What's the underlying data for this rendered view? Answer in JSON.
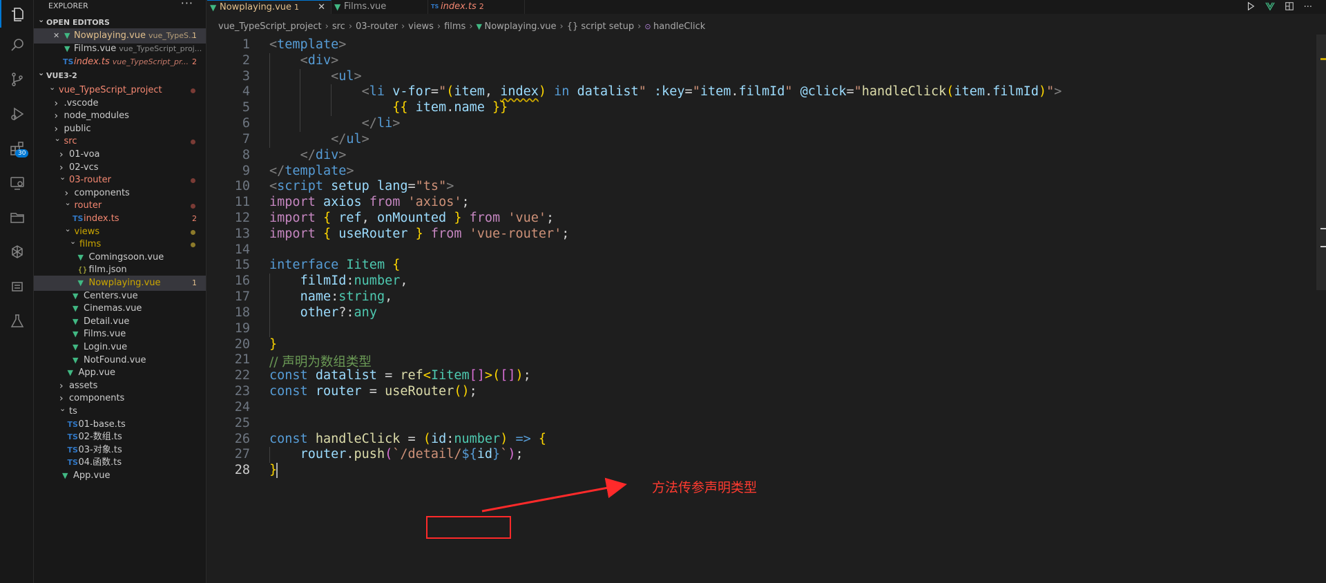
{
  "sidebar": {
    "title": "EXPLORER",
    "more": "···",
    "open_editors_label": "OPEN EDITORS",
    "open_editors": [
      {
        "name": "Nowplaying.vue",
        "desc": "vue_TypeS...",
        "count": "1",
        "kind": "vue",
        "state": "modified",
        "selected": true,
        "closable": true
      },
      {
        "name": "Films.vue",
        "desc": "vue_TypeScript_proj...",
        "count": "",
        "kind": "vue",
        "state": "normal"
      },
      {
        "name": "index.ts",
        "desc": "vue_TypeScript_pr...",
        "count": "2",
        "kind": "ts",
        "state": "error"
      }
    ],
    "workspace_label": "VUE3-2",
    "tree": [
      {
        "name": "vue_TypeScript_project",
        "depth": 0,
        "twisty": "open",
        "kind": "folder",
        "state": "error",
        "dot": true
      },
      {
        "name": ".vscode",
        "depth": 1,
        "twisty": "closed",
        "kind": "folder",
        "state": "normal"
      },
      {
        "name": "node_modules",
        "depth": 1,
        "twisty": "closed",
        "kind": "folder",
        "state": "normal"
      },
      {
        "name": "public",
        "depth": 1,
        "twisty": "closed",
        "kind": "folder",
        "state": "normal"
      },
      {
        "name": "src",
        "depth": 1,
        "twisty": "open",
        "kind": "folder",
        "state": "error",
        "dot": true
      },
      {
        "name": "01-voa",
        "depth": 2,
        "twisty": "closed",
        "kind": "folder",
        "state": "normal"
      },
      {
        "name": "02-vcs",
        "depth": 2,
        "twisty": "closed",
        "kind": "folder",
        "state": "normal"
      },
      {
        "name": "03-router",
        "depth": 2,
        "twisty": "open",
        "kind": "folder",
        "state": "error",
        "dot": true
      },
      {
        "name": "components",
        "depth": 3,
        "twisty": "closed",
        "kind": "folder",
        "state": "normal"
      },
      {
        "name": "router",
        "depth": 3,
        "twisty": "open",
        "kind": "folder",
        "state": "error",
        "dot": true
      },
      {
        "name": "index.ts",
        "depth": 4,
        "twisty": "",
        "kind": "ts",
        "state": "error",
        "count": "2"
      },
      {
        "name": "views",
        "depth": 3,
        "twisty": "open",
        "kind": "folder",
        "state": "warn",
        "dot": true
      },
      {
        "name": "films",
        "depth": 4,
        "twisty": "open",
        "kind": "folder",
        "state": "warn",
        "dot": true
      },
      {
        "name": "Comingsoon.vue",
        "depth": 5,
        "twisty": "",
        "kind": "vue",
        "state": "normal"
      },
      {
        "name": "film.json",
        "depth": 5,
        "twisty": "",
        "kind": "json",
        "state": "normal"
      },
      {
        "name": "Nowplaying.vue",
        "depth": 5,
        "twisty": "",
        "kind": "vue",
        "state": "warn",
        "count": "1",
        "selected": true
      },
      {
        "name": "Centers.vue",
        "depth": 4,
        "twisty": "",
        "kind": "vue",
        "state": "normal"
      },
      {
        "name": "Cinemas.vue",
        "depth": 4,
        "twisty": "",
        "kind": "vue",
        "state": "normal"
      },
      {
        "name": "Detail.vue",
        "depth": 4,
        "twisty": "",
        "kind": "vue",
        "state": "normal"
      },
      {
        "name": "Films.vue",
        "depth": 4,
        "twisty": "",
        "kind": "vue",
        "state": "normal"
      },
      {
        "name": "Login.vue",
        "depth": 4,
        "twisty": "",
        "kind": "vue",
        "state": "normal"
      },
      {
        "name": "NotFound.vue",
        "depth": 4,
        "twisty": "",
        "kind": "vue",
        "state": "normal"
      },
      {
        "name": "App.vue",
        "depth": 3,
        "twisty": "",
        "kind": "vue",
        "state": "normal"
      },
      {
        "name": "assets",
        "depth": 2,
        "twisty": "closed",
        "kind": "folder",
        "state": "normal"
      },
      {
        "name": "components",
        "depth": 2,
        "twisty": "closed",
        "kind": "folder",
        "state": "normal"
      },
      {
        "name": "ts",
        "depth": 2,
        "twisty": "open",
        "kind": "folder",
        "state": "normal"
      },
      {
        "name": "01-base.ts",
        "depth": 3,
        "twisty": "",
        "kind": "ts",
        "state": "normal"
      },
      {
        "name": "02-数组.ts",
        "depth": 3,
        "twisty": "",
        "kind": "ts",
        "state": "normal"
      },
      {
        "name": "03-对象.ts",
        "depth": 3,
        "twisty": "",
        "kind": "ts",
        "state": "normal"
      },
      {
        "name": "04.函数.ts",
        "depth": 3,
        "twisty": "",
        "kind": "ts",
        "state": "normal"
      },
      {
        "name": "App.vue",
        "depth": 2,
        "twisty": "",
        "kind": "vue",
        "state": "normal"
      }
    ]
  },
  "activity_bar": {
    "icons": [
      "files-icon",
      "search-icon",
      "source-control-icon",
      "run-debug-icon",
      "extensions-icon",
      "remote-explorer-icon",
      "folder-icon",
      "openai-icon",
      "outline-icon",
      "testing-icon"
    ],
    "extensions_badge": "30"
  },
  "tabs": [
    {
      "name": "Nowplaying.vue",
      "count": "1",
      "kind": "vue",
      "active": true
    },
    {
      "name": "Films.vue",
      "count": "",
      "kind": "vue",
      "active": false
    },
    {
      "name": "index.ts",
      "count": "2",
      "kind": "ts",
      "active": false
    }
  ],
  "tab_close": "✕",
  "breadcrumb": [
    "vue_TypeScript_project",
    "src",
    "03-router",
    "views",
    "films",
    "Nowplaying.vue",
    "{} script setup",
    "handleClick"
  ],
  "editor": {
    "current_line": 28,
    "lines": [
      [
        [
          "t-br",
          "<"
        ],
        [
          "t-tag",
          "template"
        ],
        [
          "t-br",
          ">"
        ]
      ],
      [
        [
          "t-plain",
          "    "
        ],
        [
          "t-br",
          "<"
        ],
        [
          "t-tag",
          "div"
        ],
        [
          "t-br",
          ">"
        ]
      ],
      [
        [
          "t-plain",
          "        "
        ],
        [
          "t-br",
          "<"
        ],
        [
          "t-tag",
          "ul"
        ],
        [
          "t-br",
          ">"
        ]
      ],
      [
        [
          "t-plain",
          "            "
        ],
        [
          "t-br",
          "<"
        ],
        [
          "t-tag",
          "li"
        ],
        [
          "t-plain",
          " "
        ],
        [
          "t-attr",
          "v-for"
        ],
        [
          "t-plain",
          "="
        ],
        [
          "t-str",
          "\""
        ],
        [
          "t-b1",
          "("
        ],
        [
          "t-var",
          "item"
        ],
        [
          "t-plain",
          ", "
        ],
        [
          "t-var squiggle",
          "index"
        ],
        [
          "t-b1",
          ")"
        ],
        [
          "t-plain",
          " "
        ],
        [
          "t-kw2",
          "in"
        ],
        [
          "t-plain",
          " "
        ],
        [
          "t-var",
          "datalist"
        ],
        [
          "t-str",
          "\""
        ],
        [
          "t-plain",
          " "
        ],
        [
          "t-attr",
          ":key"
        ],
        [
          "t-plain",
          "="
        ],
        [
          "t-str",
          "\""
        ],
        [
          "t-var",
          "item"
        ],
        [
          "t-plain",
          "."
        ],
        [
          "t-var",
          "filmId"
        ],
        [
          "t-str",
          "\""
        ],
        [
          "t-plain",
          " "
        ],
        [
          "t-attr",
          "@click"
        ],
        [
          "t-plain",
          "="
        ],
        [
          "t-str",
          "\""
        ],
        [
          "t-fn",
          "handleClick"
        ],
        [
          "t-b1",
          "("
        ],
        [
          "t-var",
          "item"
        ],
        [
          "t-plain",
          "."
        ],
        [
          "t-var",
          "filmId"
        ],
        [
          "t-b1",
          ")"
        ],
        [
          "t-str",
          "\""
        ],
        [
          "t-br",
          ">"
        ]
      ],
      [
        [
          "t-plain",
          "                "
        ],
        [
          "t-b1",
          "{{"
        ],
        [
          "t-plain",
          " "
        ],
        [
          "t-var",
          "item"
        ],
        [
          "t-plain",
          "."
        ],
        [
          "t-var",
          "name"
        ],
        [
          "t-plain",
          " "
        ],
        [
          "t-b1",
          "}}"
        ]
      ],
      [
        [
          "t-plain",
          "            "
        ],
        [
          "t-br",
          "</"
        ],
        [
          "t-tag",
          "li"
        ],
        [
          "t-br",
          ">"
        ]
      ],
      [
        [
          "t-plain",
          "        "
        ],
        [
          "t-br",
          "</"
        ],
        [
          "t-tag",
          "ul"
        ],
        [
          "t-br",
          ">"
        ]
      ],
      [
        [
          "t-plain",
          "    "
        ],
        [
          "t-br",
          "</"
        ],
        [
          "t-tag",
          "div"
        ],
        [
          "t-br",
          ">"
        ]
      ],
      [
        [
          "t-br",
          "</"
        ],
        [
          "t-tag",
          "template"
        ],
        [
          "t-br",
          ">"
        ]
      ],
      [
        [
          "t-br",
          "<"
        ],
        [
          "t-tag",
          "script"
        ],
        [
          "t-plain",
          " "
        ],
        [
          "t-attr",
          "setup"
        ],
        [
          "t-plain",
          " "
        ],
        [
          "t-attr",
          "lang"
        ],
        [
          "t-plain",
          "="
        ],
        [
          "t-str",
          "\"ts\""
        ],
        [
          "t-br",
          ">"
        ]
      ],
      [
        [
          "t-kw",
          "import"
        ],
        [
          "t-plain",
          " "
        ],
        [
          "t-var",
          "axios"
        ],
        [
          "t-plain",
          " "
        ],
        [
          "t-kw",
          "from"
        ],
        [
          "t-plain",
          " "
        ],
        [
          "t-str",
          "'axios'"
        ],
        [
          "t-plain",
          ";"
        ]
      ],
      [
        [
          "t-kw",
          "import"
        ],
        [
          "t-plain",
          " "
        ],
        [
          "t-b1",
          "{"
        ],
        [
          "t-plain",
          " "
        ],
        [
          "t-var",
          "ref"
        ],
        [
          "t-plain",
          ", "
        ],
        [
          "t-var",
          "onMounted"
        ],
        [
          "t-plain",
          " "
        ],
        [
          "t-b1",
          "}"
        ],
        [
          "t-plain",
          " "
        ],
        [
          "t-kw",
          "from"
        ],
        [
          "t-plain",
          " "
        ],
        [
          "t-str",
          "'vue'"
        ],
        [
          "t-plain",
          ";"
        ]
      ],
      [
        [
          "t-kw",
          "import"
        ],
        [
          "t-plain",
          " "
        ],
        [
          "t-b1",
          "{"
        ],
        [
          "t-plain",
          " "
        ],
        [
          "t-var",
          "useRouter"
        ],
        [
          "t-plain",
          " "
        ],
        [
          "t-b1",
          "}"
        ],
        [
          "t-plain",
          " "
        ],
        [
          "t-kw",
          "from"
        ],
        [
          "t-plain",
          " "
        ],
        [
          "t-str",
          "'vue-router'"
        ],
        [
          "t-plain",
          ";"
        ]
      ],
      [],
      [
        [
          "t-kw2",
          "interface"
        ],
        [
          "t-plain",
          " "
        ],
        [
          "t-type",
          "Iitem"
        ],
        [
          "t-plain",
          " "
        ],
        [
          "t-b1",
          "{"
        ]
      ],
      [
        [
          "t-plain",
          "    "
        ],
        [
          "t-var",
          "filmId"
        ],
        [
          "t-plain",
          ":"
        ],
        [
          "t-type",
          "number"
        ],
        [
          "t-plain",
          ","
        ]
      ],
      [
        [
          "t-plain",
          "    "
        ],
        [
          "t-var",
          "name"
        ],
        [
          "t-plain",
          ":"
        ],
        [
          "t-type",
          "string"
        ],
        [
          "t-plain",
          ","
        ]
      ],
      [
        [
          "t-plain",
          "    "
        ],
        [
          "t-var",
          "other"
        ],
        [
          "t-plain",
          "?:"
        ],
        [
          "t-type",
          "any"
        ]
      ],
      [],
      [
        [
          "t-b1",
          "}"
        ]
      ],
      [
        [
          "t-cm",
          "// 声明为数组类型"
        ]
      ],
      [
        [
          "t-kw2",
          "const"
        ],
        [
          "t-plain",
          " "
        ],
        [
          "t-var",
          "datalist"
        ],
        [
          "t-plain",
          " = "
        ],
        [
          "t-fn",
          "ref"
        ],
        [
          "t-b1",
          "<"
        ],
        [
          "t-type",
          "Iitem"
        ],
        [
          "t-b2",
          "[]"
        ],
        [
          "t-b1",
          ">"
        ],
        [
          "t-b1",
          "("
        ],
        [
          "t-b2",
          "[]"
        ],
        [
          "t-b1",
          ")"
        ],
        [
          "t-plain",
          ";"
        ]
      ],
      [
        [
          "t-kw2",
          "const"
        ],
        [
          "t-plain",
          " "
        ],
        [
          "t-var",
          "router"
        ],
        [
          "t-plain",
          " = "
        ],
        [
          "t-fn",
          "useRouter"
        ],
        [
          "t-b1",
          "()"
        ],
        [
          "t-plain",
          ";"
        ]
      ],
      [],
      [],
      [
        [
          "t-kw2",
          "const"
        ],
        [
          "t-plain",
          " "
        ],
        [
          "t-fn",
          "handleClick"
        ],
        [
          "t-plain",
          " = "
        ],
        [
          "t-b1",
          "("
        ],
        [
          "t-var",
          "id"
        ],
        [
          "t-plain",
          ":"
        ],
        [
          "t-type",
          "number"
        ],
        [
          "t-b1",
          ")"
        ],
        [
          "t-plain",
          " "
        ],
        [
          "t-kw2",
          "=>"
        ],
        [
          "t-plain",
          " "
        ],
        [
          "t-b1",
          "{"
        ]
      ],
      [
        [
          "t-plain",
          "    "
        ],
        [
          "t-var",
          "router"
        ],
        [
          "t-plain",
          "."
        ],
        [
          "t-fn",
          "push"
        ],
        [
          "t-b2",
          "("
        ],
        [
          "t-str",
          "`/detail/"
        ],
        [
          "t-kw2",
          "${"
        ],
        [
          "t-var",
          "id"
        ],
        [
          "t-kw2",
          "}"
        ],
        [
          "t-str",
          "`"
        ],
        [
          "t-b2",
          ")"
        ],
        [
          "t-plain",
          ";"
        ]
      ],
      [
        [
          "t-b1",
          "}"
        ]
      ]
    ]
  },
  "annotation": {
    "text": "方法传参声明类型",
    "color": "#ff3b30"
  },
  "colors": {
    "accent": "#0078d4",
    "error": "#f48771",
    "warning": "#cca700",
    "vue": "#41b883",
    "ts": "#3178c6"
  }
}
